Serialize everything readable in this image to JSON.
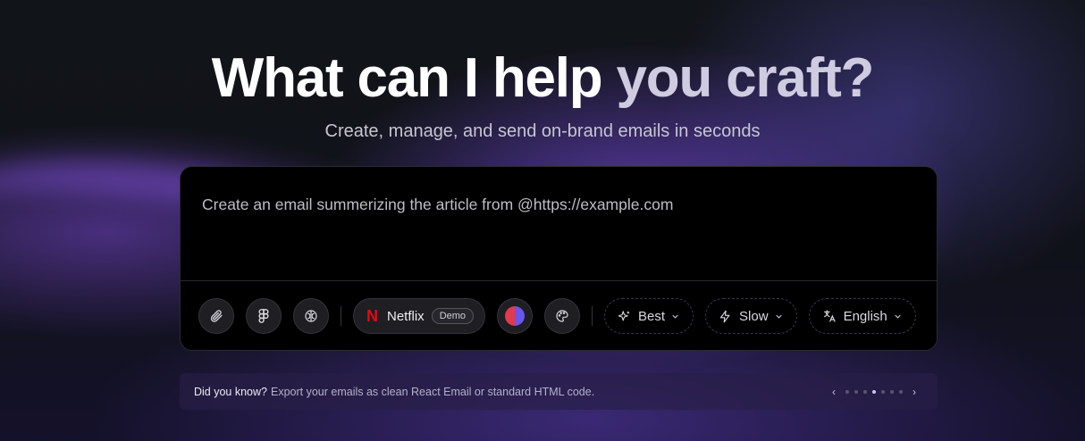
{
  "hero": {
    "title_main": "What can I help ",
    "title_muted": "you craft?",
    "subtitle": "Create, manage, and send on-brand emails in seconds"
  },
  "composer": {
    "prompt_text": "Create an email summerizing the article from @https://example.com"
  },
  "toolbar": {
    "attach_icon": "paperclip-icon",
    "figma_icon": "figma-icon",
    "brain_icon": "brain-icon",
    "brand": {
      "logo": "N",
      "name": "Netflix",
      "badge": "Demo"
    },
    "colors": {
      "left": "#e03a4e",
      "right": "#6a55f0"
    },
    "palette_icon": "palette-icon",
    "quality": "Best",
    "speed": "Slow",
    "language": "English"
  },
  "tip": {
    "lead": "Did you know?",
    "message": "Export your emails as clean React Email or standard HTML code.",
    "pager": {
      "prev": "‹",
      "next": "›",
      "count": 7,
      "active_index": 3
    }
  }
}
